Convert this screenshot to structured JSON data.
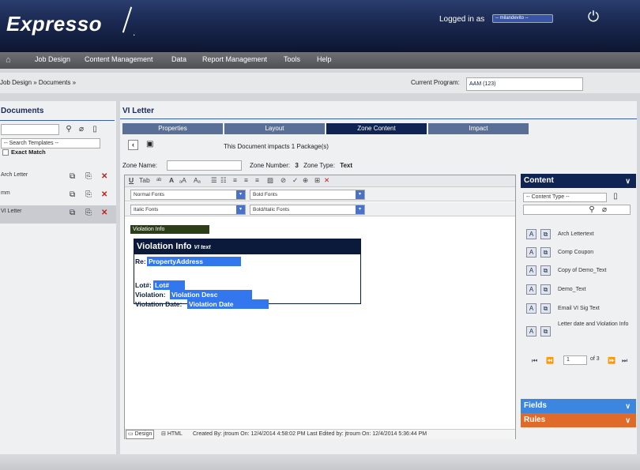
{
  "header": {
    "logo": "Expresso",
    "logged_in_label": "Logged in as",
    "user": "-- milandevito --",
    "power_icon": "power-icon"
  },
  "nav": {
    "items": [
      "Job Design",
      "Content Management",
      "Data",
      "Report Management",
      "Tools",
      "Help"
    ]
  },
  "breadcrumb": {
    "text": "Job Design  »  Documents  »",
    "current_program_label": "Current Program:",
    "current_program_value": "AAM (123)"
  },
  "sidebar": {
    "title": "Documents",
    "search_placeholder": "",
    "template_select": "-- Search Templates --",
    "exact_match": "Exact Match",
    "documents": [
      {
        "label": "Arch Letter"
      },
      {
        "label": "mm"
      },
      {
        "label": "VI Letter"
      }
    ]
  },
  "main": {
    "title": "VI Letter",
    "tabs": [
      "Properties",
      "Layout",
      "Zone Content",
      "Impact"
    ],
    "active_tab": "Zone Content",
    "impact_text": "This Document impacts 1 Package(s)",
    "zone_name_label": "Zone Name:",
    "zone_name_value": "",
    "zone_number_label": "Zone Number:",
    "zone_number": "3",
    "zone_type_label": "Zone Type:",
    "zone_type": "Text"
  },
  "editor": {
    "toolbar_tab": "Tab",
    "font_selects": {
      "normal": "Normal Fonts",
      "bold": "Bold Fonts",
      "italic": "Italic Fonts",
      "bold_italic": "Bold/Italic Fonts"
    },
    "canvas": {
      "tag": "Violation Info",
      "box_title": "Violation Info",
      "box_subtitle": "VI text",
      "re_label": "Re:",
      "re_field": "PropertyAddress",
      "lot_label": "Lot#:",
      "lot_field": "Lot#",
      "violation_label": "Violation:",
      "violation_field": "Violation Desc",
      "vdate_label": "Violation Date:",
      "vdate_field": "Violation Date"
    },
    "footer": {
      "design": "Design",
      "html": "HTML",
      "meta": "Created By: jtroum On: 12/4/2014 4:58:02 PM Last Edited by: jtroum On: 12/4/2014 5:36:44 PM"
    }
  },
  "right_panel": {
    "content_title": "Content",
    "content_type_select": "-- Content Type --",
    "items": [
      {
        "label": "Arch Lettertext"
      },
      {
        "label": "Comp Coupon"
      },
      {
        "label": "Copy of Demo_Text"
      },
      {
        "label": "Demo_Text"
      },
      {
        "label": "Email VI Sig Text"
      },
      {
        "label": "Letter date and Violation Info"
      }
    ],
    "pager": {
      "page": "1",
      "of": "of 3"
    },
    "fields_title": "Fields",
    "rules_title": "Rules"
  },
  "colors": {
    "header_dark": "#0d1630",
    "accent_blue": "#3377ee",
    "active_tab": "#0f2453",
    "fields_header": "#3d86e0",
    "rules_header": "#e06a2a"
  }
}
